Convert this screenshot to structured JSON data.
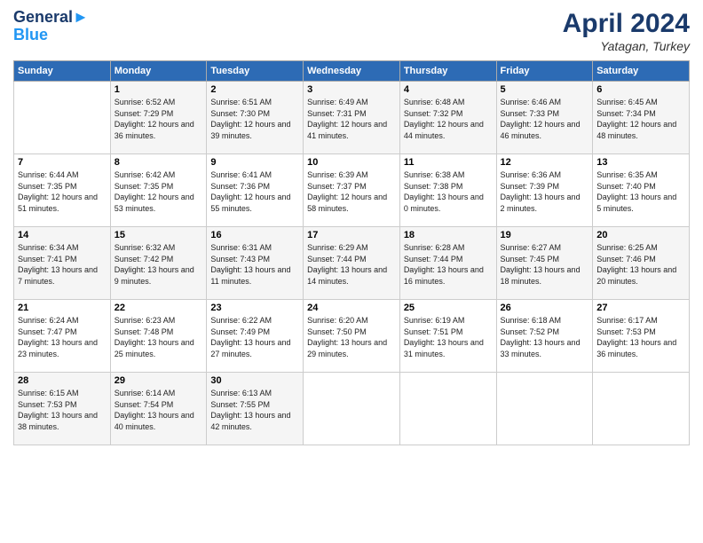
{
  "header": {
    "logo_line1": "General",
    "logo_line2": "Blue",
    "month": "April 2024",
    "location": "Yatagan, Turkey"
  },
  "weekdays": [
    "Sunday",
    "Monday",
    "Tuesday",
    "Wednesday",
    "Thursday",
    "Friday",
    "Saturday"
  ],
  "rows": [
    [
      {
        "day": "",
        "sunrise": "",
        "sunset": "",
        "daylight": ""
      },
      {
        "day": "1",
        "sunrise": "Sunrise: 6:52 AM",
        "sunset": "Sunset: 7:29 PM",
        "daylight": "Daylight: 12 hours and 36 minutes."
      },
      {
        "day": "2",
        "sunrise": "Sunrise: 6:51 AM",
        "sunset": "Sunset: 7:30 PM",
        "daylight": "Daylight: 12 hours and 39 minutes."
      },
      {
        "day": "3",
        "sunrise": "Sunrise: 6:49 AM",
        "sunset": "Sunset: 7:31 PM",
        "daylight": "Daylight: 12 hours and 41 minutes."
      },
      {
        "day": "4",
        "sunrise": "Sunrise: 6:48 AM",
        "sunset": "Sunset: 7:32 PM",
        "daylight": "Daylight: 12 hours and 44 minutes."
      },
      {
        "day": "5",
        "sunrise": "Sunrise: 6:46 AM",
        "sunset": "Sunset: 7:33 PM",
        "daylight": "Daylight: 12 hours and 46 minutes."
      },
      {
        "day": "6",
        "sunrise": "Sunrise: 6:45 AM",
        "sunset": "Sunset: 7:34 PM",
        "daylight": "Daylight: 12 hours and 48 minutes."
      }
    ],
    [
      {
        "day": "7",
        "sunrise": "Sunrise: 6:44 AM",
        "sunset": "Sunset: 7:35 PM",
        "daylight": "Daylight: 12 hours and 51 minutes."
      },
      {
        "day": "8",
        "sunrise": "Sunrise: 6:42 AM",
        "sunset": "Sunset: 7:35 PM",
        "daylight": "Daylight: 12 hours and 53 minutes."
      },
      {
        "day": "9",
        "sunrise": "Sunrise: 6:41 AM",
        "sunset": "Sunset: 7:36 PM",
        "daylight": "Daylight: 12 hours and 55 minutes."
      },
      {
        "day": "10",
        "sunrise": "Sunrise: 6:39 AM",
        "sunset": "Sunset: 7:37 PM",
        "daylight": "Daylight: 12 hours and 58 minutes."
      },
      {
        "day": "11",
        "sunrise": "Sunrise: 6:38 AM",
        "sunset": "Sunset: 7:38 PM",
        "daylight": "Daylight: 13 hours and 0 minutes."
      },
      {
        "day": "12",
        "sunrise": "Sunrise: 6:36 AM",
        "sunset": "Sunset: 7:39 PM",
        "daylight": "Daylight: 13 hours and 2 minutes."
      },
      {
        "day": "13",
        "sunrise": "Sunrise: 6:35 AM",
        "sunset": "Sunset: 7:40 PM",
        "daylight": "Daylight: 13 hours and 5 minutes."
      }
    ],
    [
      {
        "day": "14",
        "sunrise": "Sunrise: 6:34 AM",
        "sunset": "Sunset: 7:41 PM",
        "daylight": "Daylight: 13 hours and 7 minutes."
      },
      {
        "day": "15",
        "sunrise": "Sunrise: 6:32 AM",
        "sunset": "Sunset: 7:42 PM",
        "daylight": "Daylight: 13 hours and 9 minutes."
      },
      {
        "day": "16",
        "sunrise": "Sunrise: 6:31 AM",
        "sunset": "Sunset: 7:43 PM",
        "daylight": "Daylight: 13 hours and 11 minutes."
      },
      {
        "day": "17",
        "sunrise": "Sunrise: 6:29 AM",
        "sunset": "Sunset: 7:44 PM",
        "daylight": "Daylight: 13 hours and 14 minutes."
      },
      {
        "day": "18",
        "sunrise": "Sunrise: 6:28 AM",
        "sunset": "Sunset: 7:44 PM",
        "daylight": "Daylight: 13 hours and 16 minutes."
      },
      {
        "day": "19",
        "sunrise": "Sunrise: 6:27 AM",
        "sunset": "Sunset: 7:45 PM",
        "daylight": "Daylight: 13 hours and 18 minutes."
      },
      {
        "day": "20",
        "sunrise": "Sunrise: 6:25 AM",
        "sunset": "Sunset: 7:46 PM",
        "daylight": "Daylight: 13 hours and 20 minutes."
      }
    ],
    [
      {
        "day": "21",
        "sunrise": "Sunrise: 6:24 AM",
        "sunset": "Sunset: 7:47 PM",
        "daylight": "Daylight: 13 hours and 23 minutes."
      },
      {
        "day": "22",
        "sunrise": "Sunrise: 6:23 AM",
        "sunset": "Sunset: 7:48 PM",
        "daylight": "Daylight: 13 hours and 25 minutes."
      },
      {
        "day": "23",
        "sunrise": "Sunrise: 6:22 AM",
        "sunset": "Sunset: 7:49 PM",
        "daylight": "Daylight: 13 hours and 27 minutes."
      },
      {
        "day": "24",
        "sunrise": "Sunrise: 6:20 AM",
        "sunset": "Sunset: 7:50 PM",
        "daylight": "Daylight: 13 hours and 29 minutes."
      },
      {
        "day": "25",
        "sunrise": "Sunrise: 6:19 AM",
        "sunset": "Sunset: 7:51 PM",
        "daylight": "Daylight: 13 hours and 31 minutes."
      },
      {
        "day": "26",
        "sunrise": "Sunrise: 6:18 AM",
        "sunset": "Sunset: 7:52 PM",
        "daylight": "Daylight: 13 hours and 33 minutes."
      },
      {
        "day": "27",
        "sunrise": "Sunrise: 6:17 AM",
        "sunset": "Sunset: 7:53 PM",
        "daylight": "Daylight: 13 hours and 36 minutes."
      }
    ],
    [
      {
        "day": "28",
        "sunrise": "Sunrise: 6:15 AM",
        "sunset": "Sunset: 7:53 PM",
        "daylight": "Daylight: 13 hours and 38 minutes."
      },
      {
        "day": "29",
        "sunrise": "Sunrise: 6:14 AM",
        "sunset": "Sunset: 7:54 PM",
        "daylight": "Daylight: 13 hours and 40 minutes."
      },
      {
        "day": "30",
        "sunrise": "Sunrise: 6:13 AM",
        "sunset": "Sunset: 7:55 PM",
        "daylight": "Daylight: 13 hours and 42 minutes."
      },
      {
        "day": "",
        "sunrise": "",
        "sunset": "",
        "daylight": ""
      },
      {
        "day": "",
        "sunrise": "",
        "sunset": "",
        "daylight": ""
      },
      {
        "day": "",
        "sunrise": "",
        "sunset": "",
        "daylight": ""
      },
      {
        "day": "",
        "sunrise": "",
        "sunset": "",
        "daylight": ""
      }
    ]
  ]
}
